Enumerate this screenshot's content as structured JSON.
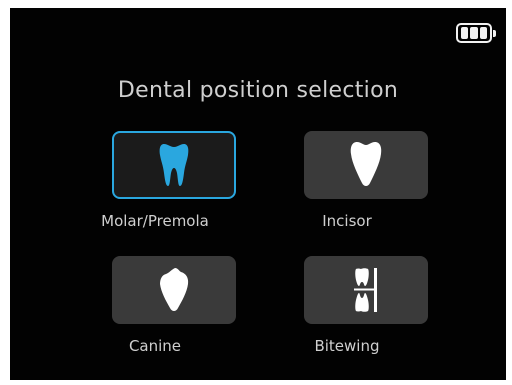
{
  "title": "Dental position selection",
  "status": {
    "battery_icon": "battery-full-icon",
    "battery_level": 1.0
  },
  "options": [
    {
      "label": "Molar/Premola",
      "icon": "molar-tooth-icon",
      "selected": true
    },
    {
      "label": "Incisor",
      "icon": "incisor-tooth-icon",
      "selected": false
    },
    {
      "label": "Canine",
      "icon": "canine-tooth-icon",
      "selected": false
    },
    {
      "label": "Bitewing",
      "icon": "bitewing-icon",
      "selected": false
    }
  ],
  "colors": {
    "accent": "#2aa7df",
    "tile_background": "#3a3a3a",
    "screen_background": "#020202",
    "text": "#cfcfcf"
  }
}
